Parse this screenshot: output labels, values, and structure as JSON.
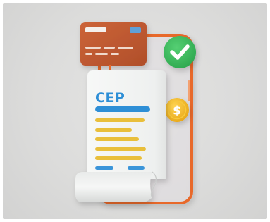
{
  "receipt": {
    "heading": "CEP"
  },
  "colors": {
    "background": "#dcdcdb",
    "accent_orange": "#e8692c",
    "card_brown": "#c25a32",
    "check_green": "#3dbb5e",
    "coin_gold": "#f2b81f",
    "heading_blue": "#2f8fd6",
    "line_yellow": "#e9bf3a",
    "paper": "#f4f5f4"
  },
  "icons": [
    "credit-card-icon",
    "checkmark-icon",
    "dollar-coin-icon",
    "receipt-icon",
    "phone-frame-icon"
  ]
}
